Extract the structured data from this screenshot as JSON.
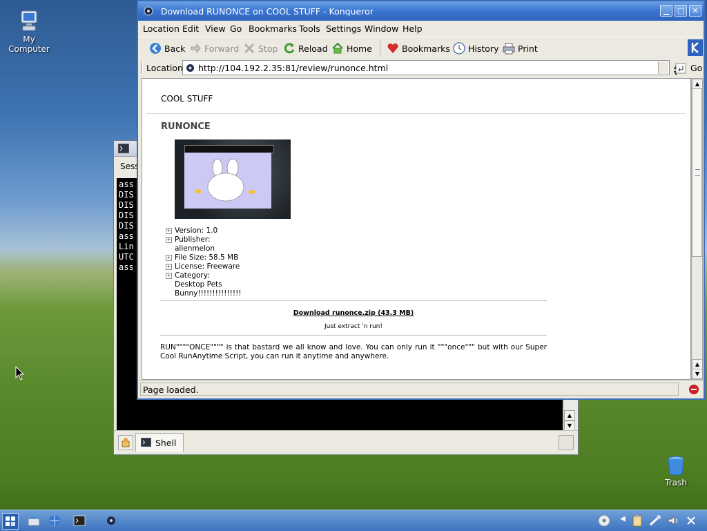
{
  "desktop": {
    "icons": [
      {
        "label": "My\nComputer",
        "name": "my-computer"
      },
      {
        "label": "Trash",
        "name": "trash"
      }
    ]
  },
  "konsole": {
    "menu_fragment": "Sess",
    "lines": [
      "ass",
      "DIS",
      "DIS",
      "DIS",
      "DIS",
      "ass",
      "Lin",
      "UTC",
      "ass"
    ],
    "tab_label": "Shell"
  },
  "browser": {
    "title": "Download RUNONCE on COOL STUFF - Konqueror",
    "menu": [
      "Location",
      "Edit",
      "View",
      "Go",
      "Bookmarks",
      "Tools",
      "Settings",
      "Window",
      "Help"
    ],
    "toolbar": {
      "back": "Back",
      "forward": "Forward",
      "stop": "Stop",
      "reload": "Reload",
      "home": "Home",
      "bookmarks": "Bookmarks",
      "history": "History",
      "print": "Print"
    },
    "location_label": "Location:",
    "url": "http://104.192.2.35:81/review/runonce.html",
    "go": "Go",
    "status": "Page loaded."
  },
  "page": {
    "site_name": "COOL STUFF",
    "title": "RUNONCE",
    "screenshot_caption": "",
    "info": {
      "version": "Version: 1.0",
      "publisher_label": "Publisher:",
      "publisher": "alienmelon",
      "file_size": "File Size: 58.5 MB",
      "license": "License: Freeware",
      "category_label": "Category:",
      "category": "Desktop Pets",
      "category2": "Bunny!!!!!!!!!!!!!!!"
    },
    "download_link": "Download runonce.zip (43.3 MB)",
    "download_note": "Just extract 'n run!",
    "description": "RUN\"\"\"\"ONCE\"\"\"\" is that bastard we all know and love. You can only run it \"\"\"once\"\"\" but with our Super Cool RunAnytime Script, you can run it anytime and anywhere."
  }
}
